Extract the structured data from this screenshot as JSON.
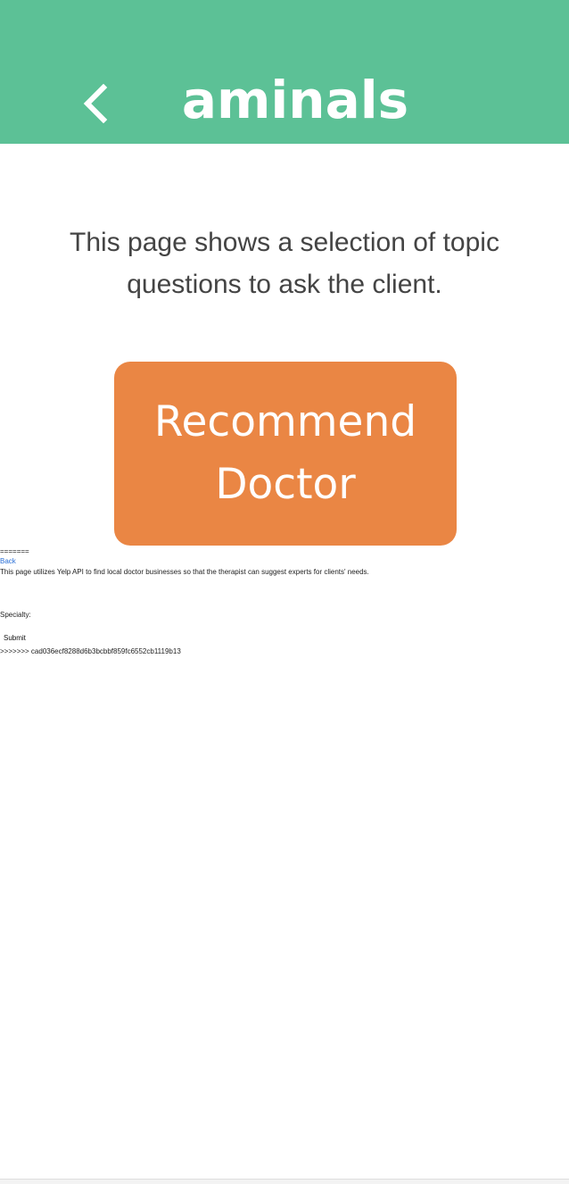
{
  "header": {
    "title": "aminals",
    "back_icon": "chevron-left-icon",
    "background_color": "#5cc196"
  },
  "intro": {
    "text": "This page shows a selection of topic questions to ask the client."
  },
  "recommend_button": {
    "label": "Recommend Doctor",
    "color": "#ea8644"
  },
  "debug": {
    "merge_separator": "=======",
    "back_link": "Back",
    "description": "This page utilizes Yelp API to find local doctor businesses so that the therapist can suggest experts for clients' needs.",
    "specialty_label": "Specialty:",
    "submit_label": "Submit",
    "merge_marker": ">>>>>>> cad036ecf8288d6b3bcbbf859fc6552cb1119b13"
  }
}
